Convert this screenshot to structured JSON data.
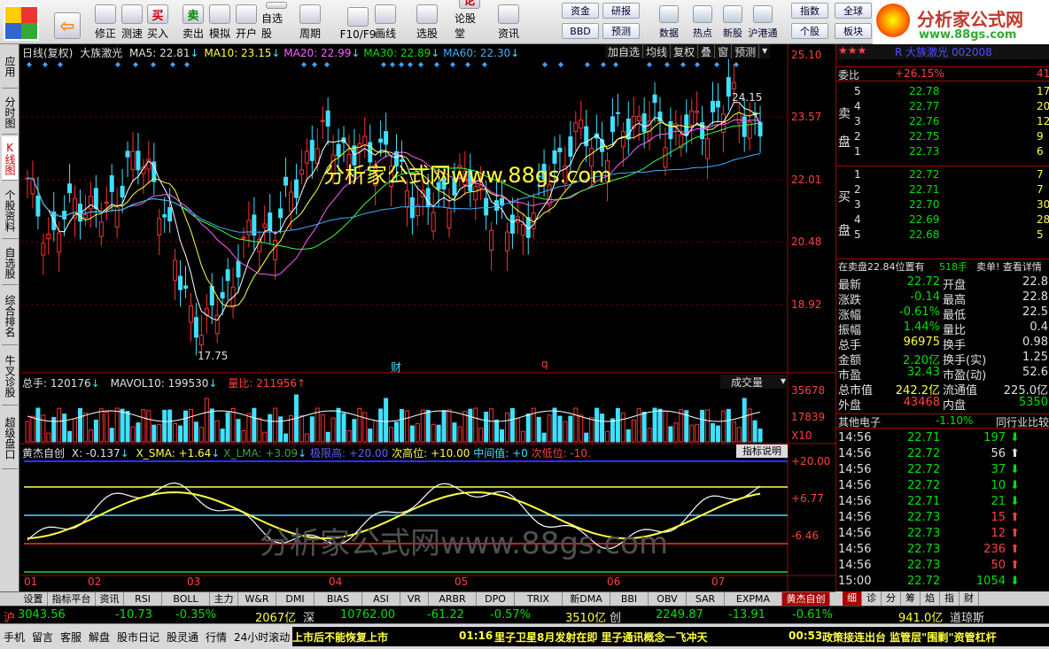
{
  "toolbar": {
    "buttons": [
      {
        "id": "back",
        "label": "",
        "icon": "back-arrow-icon"
      },
      {
        "id": "fix",
        "label": "修正",
        "icon": "refresh-icon"
      },
      {
        "id": "test",
        "label": "测速",
        "icon": "clock-icon"
      },
      {
        "id": "buy",
        "label": "买入",
        "icon": "buy-icon",
        "glyph": "买"
      },
      {
        "id": "sell",
        "label": "卖出",
        "icon": "sell-icon",
        "glyph": "卖"
      },
      {
        "id": "sim",
        "label": "模拟",
        "icon": "hammer-icon"
      },
      {
        "id": "open",
        "label": "开户",
        "icon": "lock-icon"
      },
      {
        "id": "self",
        "label": "自选股",
        "icon": "star-icon"
      },
      {
        "id": "cycle",
        "label": "周期",
        "icon": "cycle-icon"
      },
      {
        "id": "f10",
        "label": "F10/F9",
        "icon": "f10-icon"
      },
      {
        "id": "draw",
        "label": "画线",
        "icon": "pen-icon"
      },
      {
        "id": "pick",
        "label": "选股",
        "icon": "screen-icon"
      },
      {
        "id": "forum",
        "label": "论股堂",
        "icon": "forum-icon",
        "glyph": "论"
      },
      {
        "id": "info",
        "label": "资讯",
        "icon": "info-icon"
      }
    ],
    "small": [
      "资金",
      "研报",
      "BBD",
      "预测",
      "数据",
      "热点",
      "新股",
      "沪港通",
      "指数",
      "全球",
      "个股",
      "板块"
    ],
    "logo_text": "分析家公式网",
    "logo_url": "www.88gs.com"
  },
  "left_tabs": [
    "应用",
    "分时图",
    "K线图",
    "个股资料",
    "自选股",
    "综合排名",
    "牛叉诊股",
    "超级盘口"
  ],
  "chart": {
    "header": {
      "period": "日线(复权)",
      "name": "大族激光",
      "ma5": "MA5: 22.81",
      "ma10": "MA10: 23.15",
      "ma20": "MA20: 22.99",
      "ma30": "MA30: 22.89",
      "ma60": "MA60: 22.30"
    },
    "menu": [
      "加自选",
      "均线",
      "复权",
      "叠",
      "窗",
      "预测"
    ],
    "price_axis": [
      "25.10",
      "23.57",
      "22.01",
      "20.48",
      "18.92"
    ],
    "high_label": "24.15",
    "low_label": "17.75",
    "markers": [
      "财",
      "q"
    ],
    "watermark": "分析家公式网www.88gs.com",
    "vol_header": {
      "total": "总手: 120176",
      "mavol": "MAVOL10: 199530",
      "ratio": "量比: 211956"
    },
    "vol_select": "成交量",
    "vol_axis": [
      "35678",
      "17839",
      "X10"
    ],
    "ind_header": {
      "name": "黄杰自创",
      "x": "X: -0.137",
      "xsma": "X_SMA: +1.64",
      "xlma": "X_LMA: +3.09",
      "high": "极限高: +20.00",
      "second": "次高位: +10.00",
      "mid": "中间值: +0",
      "low": "次低位: -10."
    },
    "ind_help": "指标说明",
    "ind_axis": [
      "+20.00",
      "+6.77",
      "-6.46"
    ],
    "ind_watermark": "分析家公式网www.88gs.com",
    "months": [
      "01",
      "02",
      "03",
      "04",
      "05",
      "06",
      "07"
    ],
    "colors": {
      "up": "#ff3030",
      "down": "#40e0ff",
      "ma5": "#ffffff",
      "ma10": "#ffff40",
      "ma20": "#ff60ff",
      "ma30": "#40ff40",
      "ma60": "#40b0ff"
    }
  },
  "bottom_tabs": [
    "设置",
    "指标平台",
    "资讯",
    "RSI",
    "BOLL",
    "主力",
    "W&R",
    "DMI",
    "BIAS",
    "ASI",
    "VR",
    "ARBR",
    "DPO",
    "TRIX",
    "新DMA",
    "BBI",
    "OBV",
    "SAR",
    "EXPMA",
    "黄杰自创"
  ],
  "right_tabs": [
    "细",
    "诊",
    "分",
    "筹",
    "焰",
    "指",
    "财"
  ],
  "quote": {
    "title": "R 大族激光 002008",
    "weibi_label": "委比",
    "weibi": "+26.15%",
    "weicha": "41",
    "sell_label": [
      "卖",
      "盘"
    ],
    "buy_label": [
      "买",
      "盘"
    ],
    "sell": [
      {
        "n": "5",
        "p": "22.78",
        "v": "17"
      },
      {
        "n": "4",
        "p": "22.77",
        "v": "20"
      },
      {
        "n": "3",
        "p": "22.76",
        "v": "12"
      },
      {
        "n": "2",
        "p": "22.75",
        "v": "9"
      },
      {
        "n": "1",
        "p": "22.73",
        "v": "6"
      }
    ],
    "buy": [
      {
        "n": "1",
        "p": "22.72",
        "v": "7"
      },
      {
        "n": "2",
        "p": "22.71",
        "v": "7"
      },
      {
        "n": "3",
        "p": "22.70",
        "v": "30"
      },
      {
        "n": "4",
        "p": "22.69",
        "v": "28"
      },
      {
        "n": "5",
        "p": "22.68",
        "v": "5"
      }
    ],
    "note": "在卖盘22.84位置有",
    "note_vol": "518手",
    "note_tail": "卖单! 查看详情",
    "stats": [
      {
        "l": "最新",
        "v": "22.72",
        "l2": "开盘",
        "v2": "22.8"
      },
      {
        "l": "涨跌",
        "v": "-0.14",
        "l2": "最高",
        "v2": "22.8"
      },
      {
        "l": "涨幅",
        "v": "-0.61%",
        "l2": "最低",
        "v2": "22.5"
      },
      {
        "l": "振幅",
        "v": "1.44%",
        "l2": "量比",
        "v2": "0.4"
      },
      {
        "l": "总手",
        "v": "96975",
        "l2": "换手",
        "v2": "0.98"
      },
      {
        "l": "金额",
        "v": "2.20亿",
        "l2": "换手(实)",
        "v2": "1.25"
      },
      {
        "l": "市盈",
        "v": "32.43",
        "l2": "市盈(动)",
        "v2": "52.6"
      },
      {
        "l": "总市值",
        "v": "242.2亿",
        "l2": "流通值",
        "v2": "225.0亿"
      },
      {
        "l": "外盘",
        "v": "43468",
        "l2": "内盘",
        "v2": "5350"
      }
    ],
    "sector": "其他电子",
    "sector_chg": "-1.10%",
    "compare": "同行业比较",
    "ticks": [
      {
        "t": "14:56",
        "p": "22.71",
        "v": "197",
        "d": "down"
      },
      {
        "t": "14:56",
        "p": "22.72",
        "v": "56",
        "d": "up_w"
      },
      {
        "t": "14:56",
        "p": "22.72",
        "v": "37",
        "d": "down"
      },
      {
        "t": "14:56",
        "p": "22.72",
        "v": "10",
        "d": "down"
      },
      {
        "t": "14:56",
        "p": "22.71",
        "v": "21",
        "d": "down"
      },
      {
        "t": "14:56",
        "p": "22.73",
        "v": "15",
        "d": "up"
      },
      {
        "t": "14:56",
        "p": "22.73",
        "v": "12",
        "d": "up"
      },
      {
        "t": "14:56",
        "p": "22.73",
        "v": "236",
        "d": "up"
      },
      {
        "t": "14:56",
        "p": "22.73",
        "v": "50",
        "d": "up"
      },
      {
        "t": "15:00",
        "p": "22.72",
        "v": "1054",
        "d": "down"
      }
    ]
  },
  "status": {
    "sh_label": "沪",
    "sh": "3043.56",
    "sh_chg": "-10.73",
    "sh_pct": "-0.35%",
    "sh_amt": "2067亿",
    "sz_label": "深",
    "sz": "10762.00",
    "sz_chg": "-61.22",
    "sz_pct": "-0.57%",
    "sz_amt": "3510亿",
    "cy_label": "创",
    "cy": "2249.87",
    "cy_chg": "-13.91",
    "cy_pct": "-0.61%",
    "cy_amt": "941.0亿",
    "dj": "道琼斯"
  },
  "footer": {
    "items": [
      "手机",
      "留言",
      "客服",
      "解盘",
      "股市日记",
      "股灵通",
      "行情",
      "24小时滚动"
    ],
    "news1": "上市后不能恢复上市",
    "news2_time": "01:16",
    "news2": "里子卫星8月发射在即 里子通讯概念一飞冲天",
    "news3_time": "00:53",
    "news3": "政策接连出台 监管层\"围剿\"资管杠杆"
  }
}
